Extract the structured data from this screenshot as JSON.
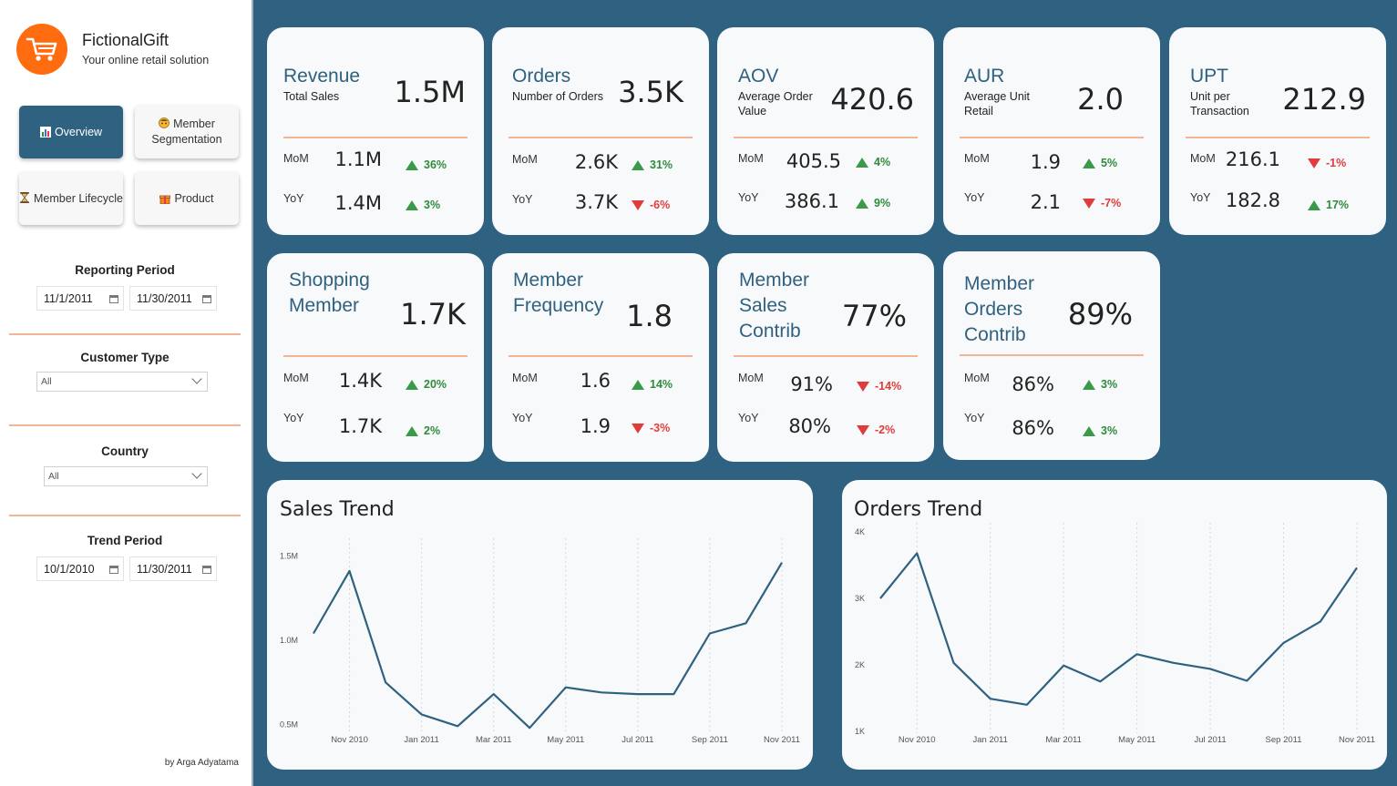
{
  "brand": {
    "name": "FictionalGift",
    "tagline": "Your online retail solution",
    "color": "#ff6b0f"
  },
  "nav": {
    "overview": "Overview",
    "member_segmentation": "Member Segmentation",
    "member_lifecycle": "Member Lifecycle",
    "product": "Product"
  },
  "filters": {
    "reporting_period": {
      "label": "Reporting Period",
      "start": "11/1/2011",
      "end": "11/30/2011"
    },
    "customer_type": {
      "label": "Customer Type",
      "value": "All"
    },
    "country": {
      "label": "Country",
      "value": "All"
    },
    "trend_period": {
      "label": "Trend Period",
      "start": "10/1/2010",
      "end": "11/30/2011"
    }
  },
  "credit": "by Arga Adyatama",
  "labels": {
    "mom": "MoM",
    "yoy": "YoY"
  },
  "kpis": [
    {
      "title": "Revenue",
      "subtitle": "Total Sales",
      "value": "1.5M",
      "mom": "1.1M",
      "mom_chg": "36%",
      "mom_dir": "up",
      "yoy": "1.4M",
      "yoy_chg": "3%",
      "yoy_dir": "up"
    },
    {
      "title": "Orders",
      "subtitle": "Number of Orders",
      "value": "3.5K",
      "mom": "2.6K",
      "mom_chg": "31%",
      "mom_dir": "up",
      "yoy": "3.7K",
      "yoy_chg": "-6%",
      "yoy_dir": "down"
    },
    {
      "title": "AOV",
      "subtitle": "Average Order Value",
      "value": "420.6",
      "mom": "405.5",
      "mom_chg": "4%",
      "mom_dir": "up",
      "yoy": "386.1",
      "yoy_chg": "9%",
      "yoy_dir": "up"
    },
    {
      "title": "AUR",
      "subtitle": "Average Unit Retail",
      "value": "2.0",
      "mom": "1.9",
      "mom_chg": "5%",
      "mom_dir": "up",
      "yoy": "2.1",
      "yoy_chg": "-7%",
      "yoy_dir": "down"
    },
    {
      "title": "UPT",
      "subtitle": "Unit per Transaction",
      "value": "212.9",
      "mom": "216.1",
      "mom_chg": "-1%",
      "mom_dir": "down",
      "yoy": "182.8",
      "yoy_chg": "17%",
      "yoy_dir": "up"
    },
    {
      "title": "Shopping Member",
      "subtitle": "",
      "value": "1.7K",
      "mom": "1.4K",
      "mom_chg": "20%",
      "mom_dir": "up",
      "yoy": "1.7K",
      "yoy_chg": "2%",
      "yoy_dir": "up"
    },
    {
      "title": "Member Frequency",
      "subtitle": "",
      "value": "1.8",
      "mom": "1.6",
      "mom_chg": "14%",
      "mom_dir": "up",
      "yoy": "1.9",
      "yoy_chg": "-3%",
      "yoy_dir": "down"
    },
    {
      "title": "Member Sales Contrib",
      "subtitle": "",
      "value": "77%",
      "mom": "91%",
      "mom_chg": "-14%",
      "mom_dir": "down",
      "yoy": "80%",
      "yoy_chg": "-2%",
      "yoy_dir": "down"
    },
    {
      "title": "Member Orders Contrib",
      "subtitle": "",
      "value": "89%",
      "mom": "86%",
      "mom_chg": "3%",
      "mom_dir": "up",
      "yoy": "86%",
      "yoy_chg": "3%",
      "yoy_dir": "up"
    }
  ],
  "colors": {
    "accent": "#2f6180",
    "divider": "#f3b494",
    "up": "#2e8b3c",
    "down": "#e03c3c"
  },
  "chart_data": [
    {
      "type": "line",
      "title": "Sales Trend",
      "x": [
        "Oct 2010",
        "Nov 2010",
        "Dec 2010",
        "Jan 2011",
        "Feb 2011",
        "Mar 2011",
        "Apr 2011",
        "May 2011",
        "Jun 2011",
        "Jul 2011",
        "Aug 2011",
        "Sep 2011",
        "Oct 2011",
        "Nov 2011"
      ],
      "x_tick_labels": [
        "Nov 2010",
        "Jan 2011",
        "Mar 2011",
        "May 2011",
        "Jul 2011",
        "Sep 2011",
        "Nov 2011"
      ],
      "values": [
        1040000,
        1410000,
        750000,
        560000,
        490000,
        680000,
        480000,
        720000,
        690000,
        680000,
        680000,
        1040000,
        1100000,
        1460000
      ],
      "y_tick_labels": [
        "1.5M",
        "1.0M",
        "0.5M"
      ],
      "y_ticks": [
        1500000,
        1000000,
        500000
      ],
      "ylim": [
        400000,
        1550000
      ],
      "grid": "vertical dotted"
    },
    {
      "type": "line",
      "title": "Orders Trend",
      "x": [
        "Oct 2010",
        "Nov 2010",
        "Dec 2010",
        "Jan 2011",
        "Feb 2011",
        "Mar 2011",
        "Apr 2011",
        "May 2011",
        "Jun 2011",
        "Jul 2011",
        "Aug 2011",
        "Sep 2011",
        "Oct 2011",
        "Nov 2011"
      ],
      "x_tick_labels": [
        "Nov 2010",
        "Jan 2011",
        "Mar 2011",
        "May 2011",
        "Jul 2011",
        "Sep 2011",
        "Nov 2011"
      ],
      "values": [
        3000,
        3680,
        2030,
        1490,
        1400,
        1990,
        1750,
        2160,
        2030,
        1940,
        1760,
        2330,
        2650,
        3460
      ],
      "y_tick_labels": [
        "4K",
        "3K",
        "2K",
        "1K"
      ],
      "y_ticks": [
        4000,
        3000,
        2000,
        1000
      ],
      "ylim": [
        1000,
        4000
      ],
      "grid": "vertical dotted"
    }
  ]
}
